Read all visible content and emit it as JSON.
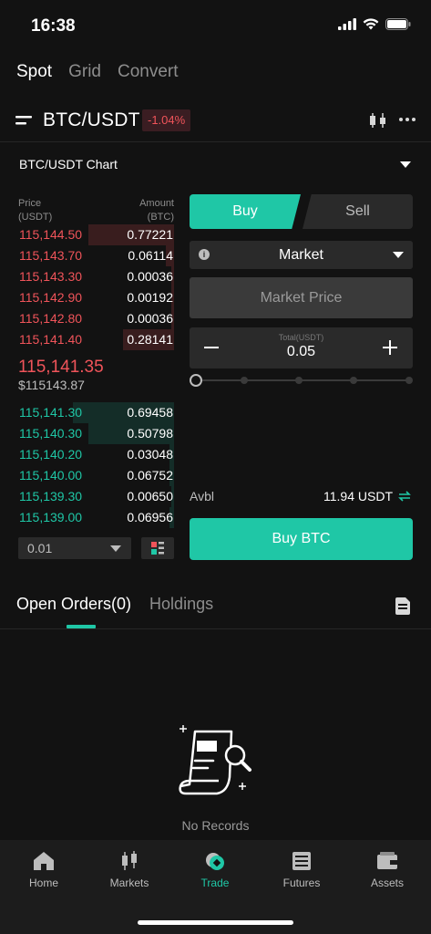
{
  "status_bar": {
    "time": "16:38"
  },
  "top_tabs": [
    {
      "label": "Spot",
      "active": true
    },
    {
      "label": "Grid",
      "active": false
    },
    {
      "label": "Convert",
      "active": false
    }
  ],
  "pair": {
    "name": "BTC/USDT",
    "change": "-1.04%"
  },
  "chart_toggle": {
    "label": "BTC/USDT Chart"
  },
  "orderbook": {
    "price_header": [
      "Price",
      "(USDT)"
    ],
    "amount_header": [
      "Amount",
      "(BTC)"
    ],
    "asks": [
      {
        "price": "115,144.50",
        "amount": "0.77221",
        "depth": 0.55
      },
      {
        "price": "115,143.70",
        "amount": "0.06114",
        "depth": 0.05
      },
      {
        "price": "115,143.30",
        "amount": "0.00036",
        "depth": 0.02
      },
      {
        "price": "115,142.90",
        "amount": "0.00192",
        "depth": 0.02
      },
      {
        "price": "115,142.80",
        "amount": "0.00036",
        "depth": 0.02
      },
      {
        "price": "115,141.40",
        "amount": "0.28141",
        "depth": 0.33
      }
    ],
    "last_price": "115,141.35",
    "last_price_usd": "$115143.87",
    "bids": [
      {
        "price": "115,141.30",
        "amount": "0.69458",
        "depth": 0.65
      },
      {
        "price": "115,140.30",
        "amount": "0.50798",
        "depth": 0.55
      },
      {
        "price": "115,140.20",
        "amount": "0.03048",
        "depth": 0.03
      },
      {
        "price": "115,140.00",
        "amount": "0.06752",
        "depth": 0.03
      },
      {
        "price": "115,139.30",
        "amount": "0.00650",
        "depth": 0.02
      },
      {
        "price": "115,139.00",
        "amount": "0.06956",
        "depth": 0.03
      }
    ],
    "depth_value": "0.01"
  },
  "trade_form": {
    "buy_tab": "Buy",
    "sell_tab": "Sell",
    "order_type": "Market",
    "info_glyph": "i",
    "price_field": "Market Price",
    "total_label": "Total(USDT)",
    "total_value": "0.05",
    "slider_level": 0,
    "avbl_label": "Avbl",
    "avbl_value": "11.94 USDT",
    "submit_label": "Buy BTC"
  },
  "orders": {
    "tabs": [
      {
        "label": "Open Orders(0)",
        "active": true
      },
      {
        "label": "Holdings",
        "active": false
      }
    ],
    "empty_text": "No Records"
  },
  "bottom_nav": [
    {
      "label": "Home",
      "icon": "home-icon",
      "active": false
    },
    {
      "label": "Markets",
      "icon": "markets-icon",
      "active": false
    },
    {
      "label": "Trade",
      "icon": "trade-icon",
      "active": true
    },
    {
      "label": "Futures",
      "icon": "futures-icon",
      "active": false
    },
    {
      "label": "Assets",
      "icon": "assets-icon",
      "active": false
    }
  ],
  "colors": {
    "accent": "#1fc7a6",
    "ask": "#f0545a",
    "background": "#121212"
  }
}
